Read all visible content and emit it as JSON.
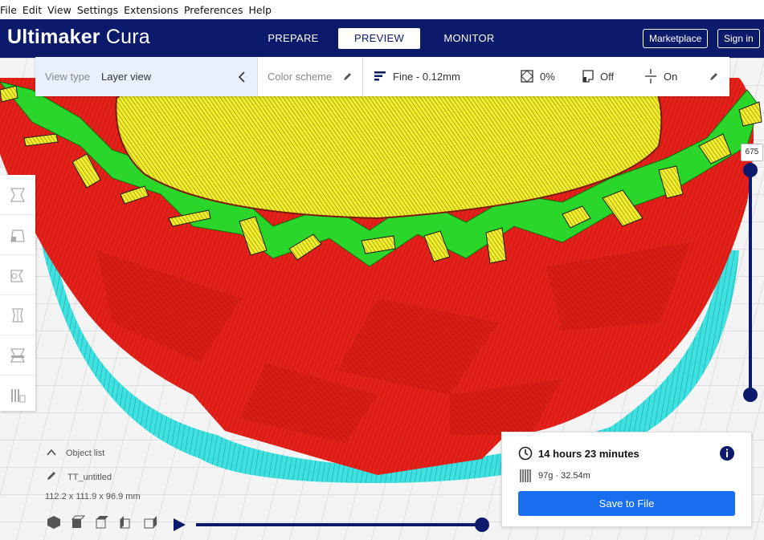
{
  "menu": [
    "File",
    "Edit",
    "View",
    "Settings",
    "Extensions",
    "Preferences",
    "Help"
  ],
  "header": {
    "logo_bold": "Ultimaker",
    "logo_light": "Cura",
    "tabs": [
      "PREPARE",
      "PREVIEW",
      "MONITOR"
    ],
    "active_tab": "PREVIEW",
    "marketplace": "Marketplace",
    "signin": "Sign in"
  },
  "toolbar": {
    "view_type_label": "View type",
    "view_type_value": "Layer view",
    "color_scheme": "Color scheme",
    "profile": "Fine - 0.12mm",
    "infill": "0%",
    "support": "Off",
    "adhesion": "On"
  },
  "layer": {
    "current": "675"
  },
  "object": {
    "list_label": "Object list",
    "name": "TT_untitled",
    "dimensions": "112.2 x 111.9 x 96.9 mm"
  },
  "print": {
    "time": "14 hours 23 minutes",
    "material": "97g · 32.54m",
    "save": "Save to File"
  },
  "colors": {
    "header_bg": "#0c1a6b",
    "accent": "#196ef0",
    "wall_red": "#e5211a",
    "skin_yellow": "#f2ee2a",
    "inner_green": "#2bd62b",
    "skirt_cyan": "#3ee0e0"
  },
  "icons": [
    "pencil-icon",
    "chevron-left-icon",
    "layers-icon",
    "infill-icon",
    "support-icon",
    "adhesion-icon",
    "clock-icon",
    "info-icon",
    "spool-icon",
    "play-icon"
  ]
}
